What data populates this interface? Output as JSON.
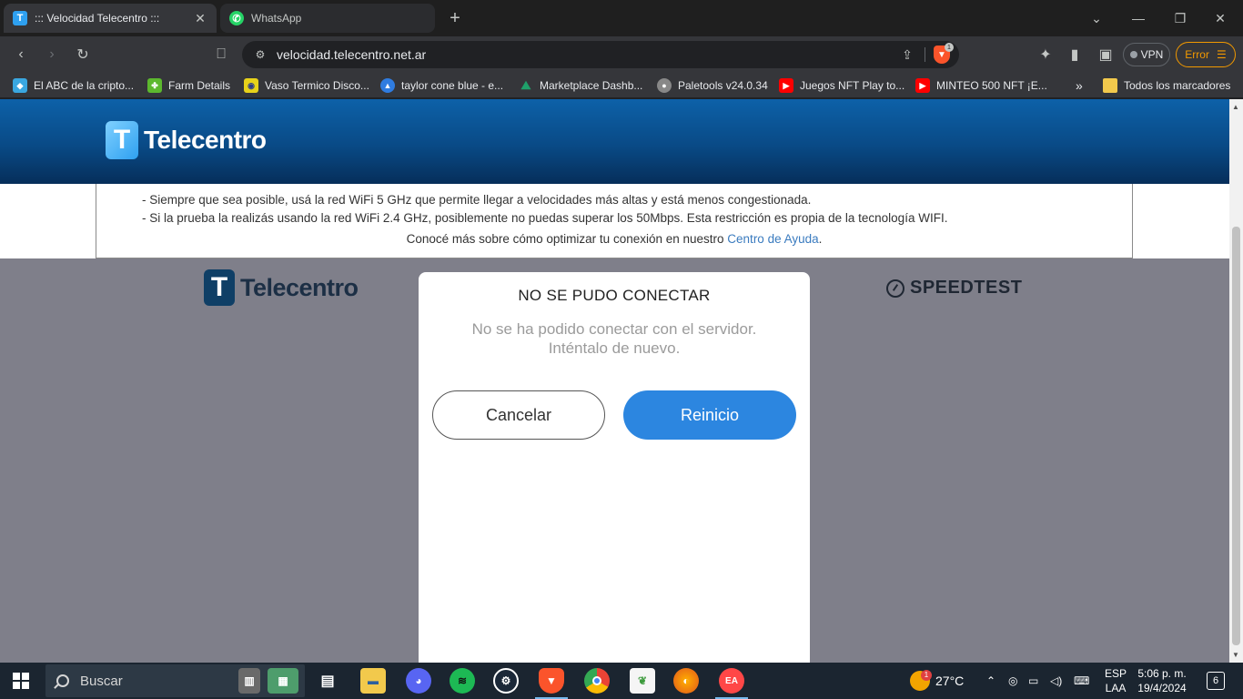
{
  "browser": {
    "tabs": [
      {
        "title": "::: Velocidad Telecentro :::",
        "active": true,
        "favicon": "telecentro-t"
      },
      {
        "title": "WhatsApp",
        "active": false,
        "favicon": "whatsapp-icon"
      }
    ],
    "url": "velocidad.telecentro.net.ar",
    "brave_shield_count": "1",
    "vpn_label": "VPN",
    "error_label": "Error",
    "bookmarks": [
      {
        "label": "El ABC de la cripto...",
        "icon": "crypto-icon",
        "color": "#3aa7e0"
      },
      {
        "label": "Farm Details",
        "icon": "clover-icon",
        "color": "#5cb82e"
      },
      {
        "label": "Vaso Termico Disco...",
        "icon": "mercadolibre-icon",
        "color": "#e7d21a"
      },
      {
        "label": "taylor cone blue - e...",
        "icon": "drop-icon",
        "color": "#2f7ce0"
      },
      {
        "label": "Marketplace Dashb...",
        "icon": "mountain-icon",
        "color": "#1fa06a"
      },
      {
        "label": "Paletools v24.0.34",
        "icon": "paletools-icon",
        "color": "#888888"
      },
      {
        "label": "Juegos NFT Play to...",
        "icon": "youtube-icon",
        "color": "#ff0000"
      },
      {
        "label": "MINTEO 500 NFT ¡E...",
        "icon": "youtube-icon",
        "color": "#ff0000"
      }
    ],
    "bookmarks_more": "»",
    "all_bookmarks": "Todos los marcadores"
  },
  "page": {
    "brand": "Telecentro",
    "tips": [
      "- Siempre que sea posible, usá la red WiFi 5 GHz que permite llegar a velocidades más altas y está menos congestionada.",
      "- Si la prueba la realizás usando la red WiFi 2.4 GHz, posiblemente no puedas superar los 50Mbps. Esta restricción es propia de la tecnología WIFI."
    ],
    "more_prefix": "Conocé más sobre cómo optimizar tu conexión en nuestro",
    "more_link": "Centro de Ayuda",
    "more_suffix": ".",
    "speedtest": "SPEEDTEST"
  },
  "modal": {
    "title": "NO SE PUDO CONECTAR",
    "message_line1": "No se ha podido conectar con el servidor.",
    "message_line2": "Inténtalo de nuevo.",
    "cancel": "Cancelar",
    "restart": "Reinicio"
  },
  "taskbar": {
    "search_placeholder": "Buscar",
    "weather_temp": "27°C",
    "weather_badge": "1",
    "lang_line1": "ESP",
    "lang_line2": "LAA",
    "time": "5:06 p. m.",
    "date": "19/4/2024",
    "notifications": "6"
  },
  "colors": {
    "header_blue": "#0d61a8",
    "restart_button": "#2c86e0",
    "overlay": "#7f7f8a"
  }
}
